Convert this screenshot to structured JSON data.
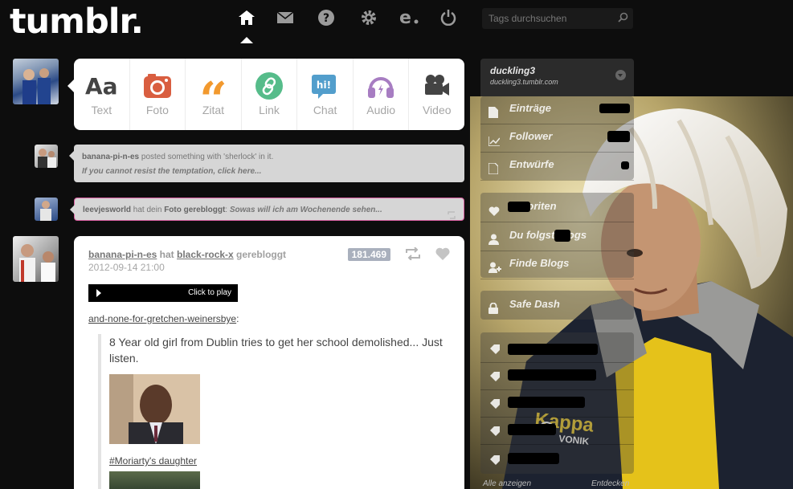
{
  "header": {
    "logo": "tumblr.",
    "search_placeholder": "Tags durchsuchen",
    "nav": [
      "home-icon",
      "mail-icon",
      "help-icon",
      "settings-icon",
      "explore-icon",
      "logout-icon"
    ]
  },
  "post_types": [
    {
      "label": "Text",
      "icon": "text-icon",
      "color": "#444444"
    },
    {
      "label": "Foto",
      "icon": "camera-icon",
      "color": "#d95e40"
    },
    {
      "label": "Zitat",
      "icon": "quote-icon",
      "color": "#f2992e"
    },
    {
      "label": "Link",
      "icon": "link-icon",
      "color": "#56bc8a"
    },
    {
      "label": "Chat",
      "icon": "chat-icon",
      "color": "#529ecc"
    },
    {
      "label": "Audio",
      "icon": "headphones-icon",
      "color": "#a77dc2"
    },
    {
      "label": "Video",
      "icon": "video-icon",
      "color": "#748089"
    }
  ],
  "notifications": [
    {
      "user": "banana-pi-n-es",
      "text": " posted something with 'sherlock' in it.",
      "sub": "If you cannot resist the temptation, click here..."
    },
    {
      "user": "leevjesworld",
      "text1": " hat dein ",
      "bold": "Foto gerebloggt",
      "text2": ": ",
      "quote": "Sowas will ich am Wochenende sehen..."
    }
  ],
  "post": {
    "user": "banana-pi-n-es",
    "verb": " hat ",
    "source_user": "black-rock-x",
    "action": " gerebloggt",
    "date": "2012-09-14 21:00",
    "notes": "181.469",
    "player_text": "Click to play",
    "source_blog": "and-none-for-gretchen-weinersbye",
    "source_colon": ":",
    "quote": "8 Year old girl from Dublin tries to get her school demolished... Just listen.",
    "tag": "#Moriarty's daughter"
  },
  "sidebar": {
    "username": "duckling3",
    "url": "duckling3.tumblr.com",
    "items": [
      {
        "label": "Einträge",
        "icon": "posts-icon"
      },
      {
        "label": "Follower",
        "icon": "followers-icon"
      },
      {
        "label": "Entwürfe",
        "icon": "drafts-icon"
      },
      {
        "label": "Favoriten",
        "icon": "heart-icon"
      },
      {
        "label": "Du folgst Blogs",
        "icon": "person-icon"
      },
      {
        "label": "Finde Blogs",
        "icon": "add-person-icon"
      },
      {
        "label": "Safe Dash",
        "icon": "lock-icon"
      }
    ],
    "footer_left": "Alle anzeigen",
    "footer_right": "Entdecken",
    "shirt_text": "Kappa"
  }
}
